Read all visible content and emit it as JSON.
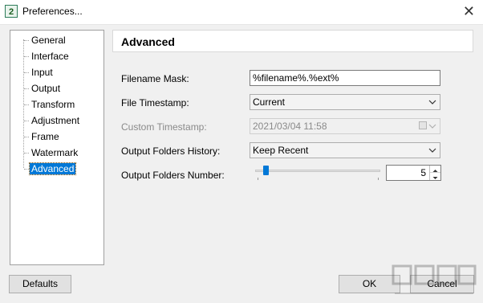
{
  "window": {
    "title": "Preferences...",
    "app_icon_glyph": "2",
    "close_glyph": "✕"
  },
  "tree": {
    "items": [
      {
        "label": "General"
      },
      {
        "label": "Interface"
      },
      {
        "label": "Input"
      },
      {
        "label": "Output"
      },
      {
        "label": "Transform"
      },
      {
        "label": "Adjustment"
      },
      {
        "label": "Frame"
      },
      {
        "label": "Watermark"
      },
      {
        "label": "Advanced",
        "selected": true
      }
    ]
  },
  "panel": {
    "title": "Advanced",
    "filename_mask": {
      "label": "Filename Mask:",
      "value": "%filename%.%ext%"
    },
    "file_timestamp": {
      "label": "File Timestamp:",
      "value": "Current"
    },
    "custom_timestamp": {
      "label": "Custom Timestamp:",
      "value": "2021/03/04 11:58",
      "disabled": true
    },
    "output_folders_history": {
      "label": "Output Folders History:",
      "value": "Keep Recent"
    },
    "output_folders_number": {
      "label": "Output Folders Number:",
      "value": "5"
    }
  },
  "buttons": {
    "defaults": "Defaults",
    "ok": "OK",
    "cancel": "Cancel"
  },
  "colors": {
    "selection": "#0078d7",
    "slider_thumb": "#0078d7",
    "disabled_text": "#8a8a8a"
  }
}
